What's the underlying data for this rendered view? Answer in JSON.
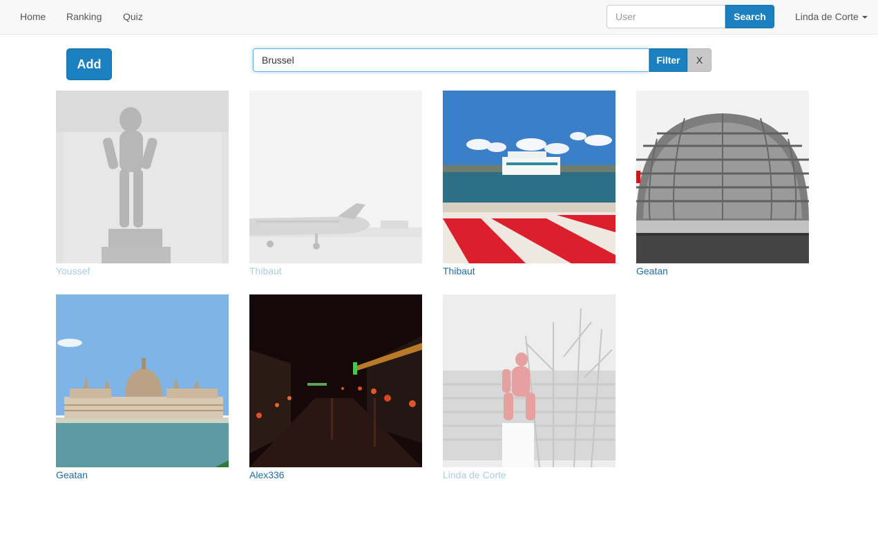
{
  "nav": {
    "links": [
      "Home",
      "Ranking",
      "Quiz"
    ],
    "search_placeholder": "User",
    "search_button": "Search",
    "user_name": "Linda de Corte"
  },
  "toolbar": {
    "add_label": "Add",
    "filter_value": "Brussel",
    "filter_button": "Filter",
    "clear_button": "X"
  },
  "colors": {
    "primary": "#1a80bf",
    "link": "#1a6fb0",
    "faded_link": "#a9cce6"
  },
  "photos": [
    {
      "owner": "Youssef",
      "subject": "manneken-pis-statue",
      "faded": true
    },
    {
      "owner": "Thibaut",
      "subject": "airplane-on-runway",
      "faded": true
    },
    {
      "owner": "Thibaut",
      "subject": "ferry-in-harbor",
      "faded": false
    },
    {
      "owner": "Geatan",
      "subject": "glass-dome",
      "faded": false
    },
    {
      "owner": "Geatan",
      "subject": "parliament-on-river",
      "faded": false
    },
    {
      "owner": "Alex336",
      "subject": "night-street-lanterns",
      "faded": false
    },
    {
      "owner": "Linda de Corte",
      "subject": "red-statue-by-trees",
      "faded": true
    }
  ]
}
